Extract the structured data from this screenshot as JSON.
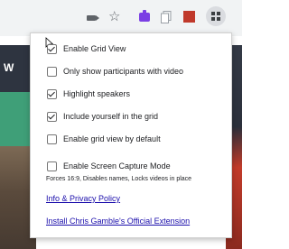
{
  "toolbar": {
    "icons": [
      "video-camera-icon",
      "star-icon",
      "extension-purple-icon",
      "extension-copy-icon",
      "extension-red-icon",
      "grid-view-extension-icon"
    ],
    "star_glyph": "☆"
  },
  "page_background": {
    "left_letter": "W"
  },
  "popup": {
    "options": [
      {
        "label": "Enable Grid View",
        "checked": true
      },
      {
        "label": "Only show participants with video",
        "checked": false
      },
      {
        "label": "Highlight speakers",
        "checked": true
      },
      {
        "label": "Include yourself in the grid",
        "checked": true
      },
      {
        "label": "Enable grid view by default",
        "checked": false
      },
      {
        "label": "Enable Screen Capture Mode",
        "checked": false
      }
    ],
    "screen_capture_note": "Forces 16:9, Disables names, Locks videos in place",
    "links": {
      "privacy": "Info & Privacy Policy",
      "official_extension": "Install Chris Gamble's Official Extension"
    }
  },
  "colors": {
    "link": "#1a0dab",
    "toolbar_bg": "#f1f3f4",
    "purple_extension": "#7b3fe4"
  }
}
